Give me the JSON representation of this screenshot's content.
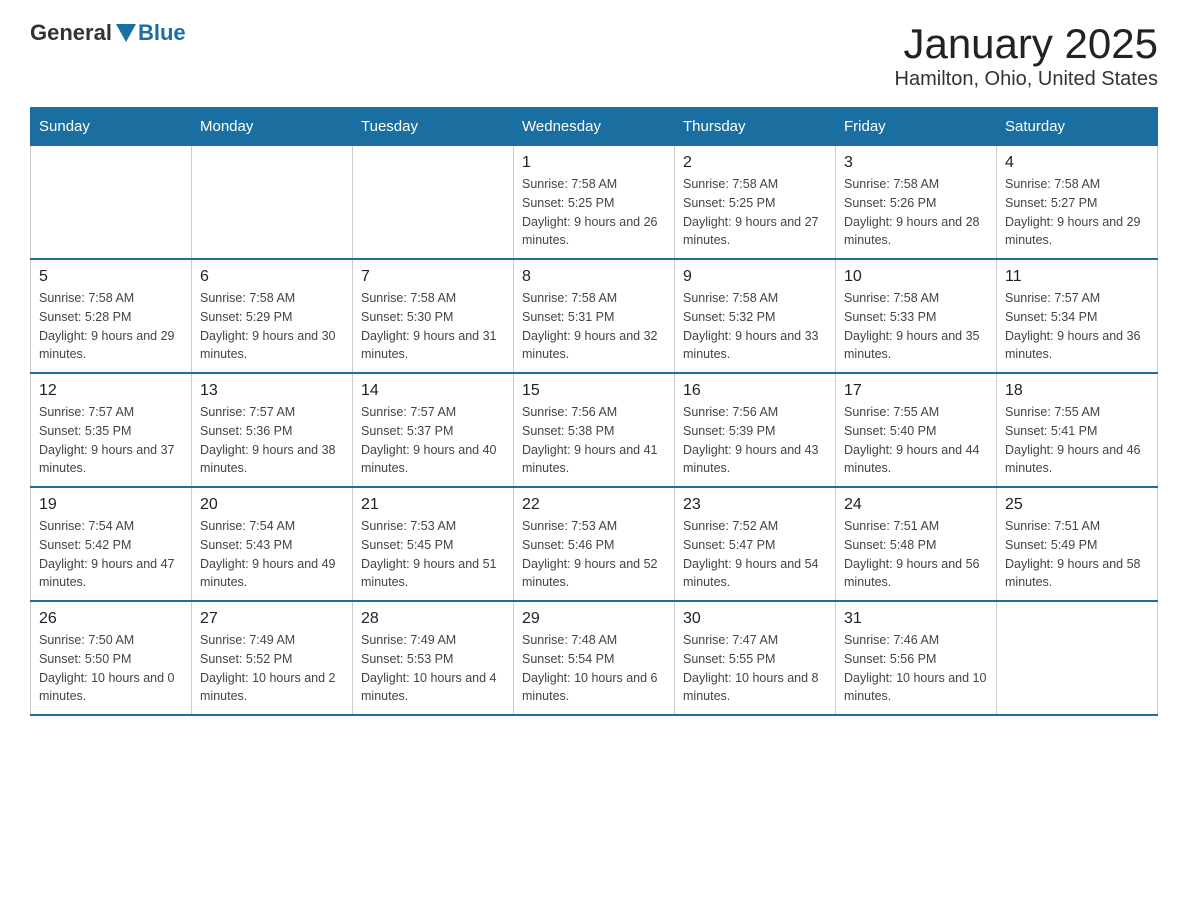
{
  "logo": {
    "general": "General",
    "blue": "Blue"
  },
  "title": "January 2025",
  "subtitle": "Hamilton, Ohio, United States",
  "days_of_week": [
    "Sunday",
    "Monday",
    "Tuesday",
    "Wednesday",
    "Thursday",
    "Friday",
    "Saturday"
  ],
  "weeks": [
    {
      "days": [
        {
          "number": "",
          "info": ""
        },
        {
          "number": "",
          "info": ""
        },
        {
          "number": "",
          "info": ""
        },
        {
          "number": "1",
          "info": "Sunrise: 7:58 AM\nSunset: 5:25 PM\nDaylight: 9 hours and 26 minutes."
        },
        {
          "number": "2",
          "info": "Sunrise: 7:58 AM\nSunset: 5:25 PM\nDaylight: 9 hours and 27 minutes."
        },
        {
          "number": "3",
          "info": "Sunrise: 7:58 AM\nSunset: 5:26 PM\nDaylight: 9 hours and 28 minutes."
        },
        {
          "number": "4",
          "info": "Sunrise: 7:58 AM\nSunset: 5:27 PM\nDaylight: 9 hours and 29 minutes."
        }
      ]
    },
    {
      "days": [
        {
          "number": "5",
          "info": "Sunrise: 7:58 AM\nSunset: 5:28 PM\nDaylight: 9 hours and 29 minutes."
        },
        {
          "number": "6",
          "info": "Sunrise: 7:58 AM\nSunset: 5:29 PM\nDaylight: 9 hours and 30 minutes."
        },
        {
          "number": "7",
          "info": "Sunrise: 7:58 AM\nSunset: 5:30 PM\nDaylight: 9 hours and 31 minutes."
        },
        {
          "number": "8",
          "info": "Sunrise: 7:58 AM\nSunset: 5:31 PM\nDaylight: 9 hours and 32 minutes."
        },
        {
          "number": "9",
          "info": "Sunrise: 7:58 AM\nSunset: 5:32 PM\nDaylight: 9 hours and 33 minutes."
        },
        {
          "number": "10",
          "info": "Sunrise: 7:58 AM\nSunset: 5:33 PM\nDaylight: 9 hours and 35 minutes."
        },
        {
          "number": "11",
          "info": "Sunrise: 7:57 AM\nSunset: 5:34 PM\nDaylight: 9 hours and 36 minutes."
        }
      ]
    },
    {
      "days": [
        {
          "number": "12",
          "info": "Sunrise: 7:57 AM\nSunset: 5:35 PM\nDaylight: 9 hours and 37 minutes."
        },
        {
          "number": "13",
          "info": "Sunrise: 7:57 AM\nSunset: 5:36 PM\nDaylight: 9 hours and 38 minutes."
        },
        {
          "number": "14",
          "info": "Sunrise: 7:57 AM\nSunset: 5:37 PM\nDaylight: 9 hours and 40 minutes."
        },
        {
          "number": "15",
          "info": "Sunrise: 7:56 AM\nSunset: 5:38 PM\nDaylight: 9 hours and 41 minutes."
        },
        {
          "number": "16",
          "info": "Sunrise: 7:56 AM\nSunset: 5:39 PM\nDaylight: 9 hours and 43 minutes."
        },
        {
          "number": "17",
          "info": "Sunrise: 7:55 AM\nSunset: 5:40 PM\nDaylight: 9 hours and 44 minutes."
        },
        {
          "number": "18",
          "info": "Sunrise: 7:55 AM\nSunset: 5:41 PM\nDaylight: 9 hours and 46 minutes."
        }
      ]
    },
    {
      "days": [
        {
          "number": "19",
          "info": "Sunrise: 7:54 AM\nSunset: 5:42 PM\nDaylight: 9 hours and 47 minutes."
        },
        {
          "number": "20",
          "info": "Sunrise: 7:54 AM\nSunset: 5:43 PM\nDaylight: 9 hours and 49 minutes."
        },
        {
          "number": "21",
          "info": "Sunrise: 7:53 AM\nSunset: 5:45 PM\nDaylight: 9 hours and 51 minutes."
        },
        {
          "number": "22",
          "info": "Sunrise: 7:53 AM\nSunset: 5:46 PM\nDaylight: 9 hours and 52 minutes."
        },
        {
          "number": "23",
          "info": "Sunrise: 7:52 AM\nSunset: 5:47 PM\nDaylight: 9 hours and 54 minutes."
        },
        {
          "number": "24",
          "info": "Sunrise: 7:51 AM\nSunset: 5:48 PM\nDaylight: 9 hours and 56 minutes."
        },
        {
          "number": "25",
          "info": "Sunrise: 7:51 AM\nSunset: 5:49 PM\nDaylight: 9 hours and 58 minutes."
        }
      ]
    },
    {
      "days": [
        {
          "number": "26",
          "info": "Sunrise: 7:50 AM\nSunset: 5:50 PM\nDaylight: 10 hours and 0 minutes."
        },
        {
          "number": "27",
          "info": "Sunrise: 7:49 AM\nSunset: 5:52 PM\nDaylight: 10 hours and 2 minutes."
        },
        {
          "number": "28",
          "info": "Sunrise: 7:49 AM\nSunset: 5:53 PM\nDaylight: 10 hours and 4 minutes."
        },
        {
          "number": "29",
          "info": "Sunrise: 7:48 AM\nSunset: 5:54 PM\nDaylight: 10 hours and 6 minutes."
        },
        {
          "number": "30",
          "info": "Sunrise: 7:47 AM\nSunset: 5:55 PM\nDaylight: 10 hours and 8 minutes."
        },
        {
          "number": "31",
          "info": "Sunrise: 7:46 AM\nSunset: 5:56 PM\nDaylight: 10 hours and 10 minutes."
        },
        {
          "number": "",
          "info": ""
        }
      ]
    }
  ]
}
